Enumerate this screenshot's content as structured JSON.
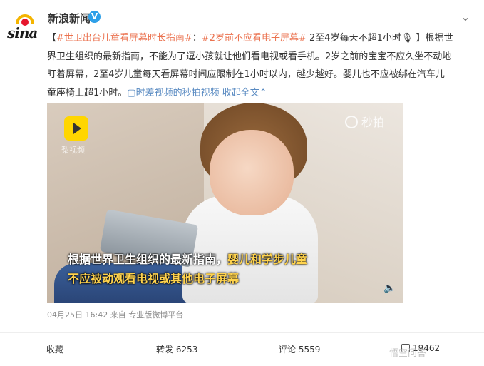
{
  "header": {
    "avatar_logo": "sina",
    "account_name": "新浪新闻",
    "verified_mark": "V",
    "menu_icon": "chevron-down-icon"
  },
  "post": {
    "tag": "#世卫出台儿童看屏幕时长指南#",
    "tag2": "#2岁前不应看电子屏幕#",
    "body1": "：",
    "body2": " 2至4岁每天不超1小时",
    "mic_icon": "🎙",
    "body3": " 】根据世界卫生组织的最新指南，不能为了逗小孩就让他们看电视或看手机。2岁之前的宝宝不应久坐不动地盯着屏幕，2至4岁儿童每天看屏幕时间应限制在1小时以内，越少越好。婴儿也不应被绑在汽车儿童座椅上超1小时。",
    "link": "时差视频的秒拍视频",
    "expand": "收起全文",
    "open_bracket": "【"
  },
  "video": {
    "app_logo_label": "梨视频",
    "watermark": "秒拍",
    "subtitle_line1": "根据世界卫生组织的最新指南，",
    "subtitle_line1_hl": "婴儿和学步儿童",
    "subtitle_line2": "不应被动观看电视或其他电子屏幕",
    "volume_icon": "speaker-icon"
  },
  "meta": {
    "date": "04月25日 16:42",
    "source": "来自 专业版微博平台"
  },
  "actions": {
    "favorite": "收藏",
    "repost": "转发 6253",
    "comment": "评论 5559",
    "like": "19462"
  },
  "corner_watermark": "悟空问答"
}
